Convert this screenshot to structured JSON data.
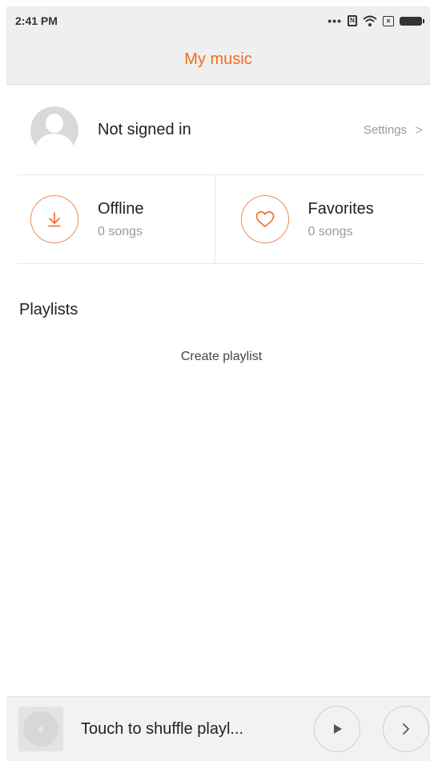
{
  "status_bar": {
    "time": "2:41 PM",
    "icons": [
      "more-dots-icon",
      "nfc-icon",
      "wifi-icon",
      "sim-icon",
      "battery-icon"
    ]
  },
  "header": {
    "title": "My music"
  },
  "account": {
    "name": "Not signed in",
    "settings_label": "Settings"
  },
  "quick_access": [
    {
      "title": "Offline",
      "subtitle": "0 songs",
      "icon": "download-icon"
    },
    {
      "title": "Favorites",
      "subtitle": "0 songs",
      "icon": "heart-icon"
    }
  ],
  "playlists": {
    "section_title": "Playlists",
    "create_label": "Create playlist"
  },
  "player": {
    "track_label": "Touch to shuffle playl...",
    "play_icon": "play-icon",
    "next_icon": "chevron-right-icon"
  },
  "colors": {
    "accent": "#f06b1f",
    "bar_background": "#efefef"
  }
}
